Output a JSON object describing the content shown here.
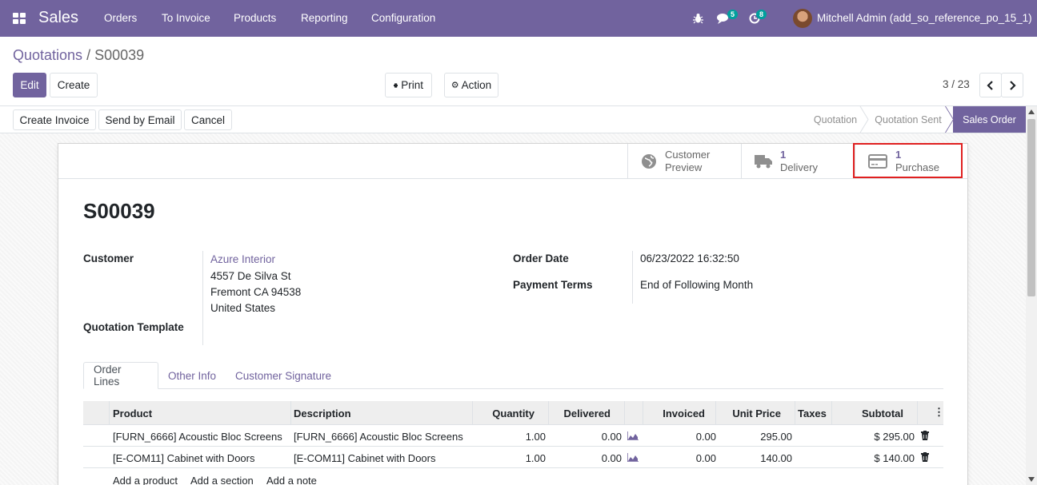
{
  "navbar": {
    "app": "Sales",
    "menu": [
      "Orders",
      "To Invoice",
      "Products",
      "Reporting",
      "Configuration"
    ],
    "chat_count": "5",
    "activity_count": "8",
    "user": "Mitchell Admin (add_so_reference_po_15_1)"
  },
  "breadcrumb": {
    "parent": "Quotations",
    "sep": " / ",
    "current": "S00039"
  },
  "buttons": {
    "edit": "Edit",
    "create": "Create",
    "print": "Print",
    "action": "Action"
  },
  "pager": {
    "value": "3 / 23"
  },
  "header_buttons": {
    "create_invoice": "Create Invoice",
    "send_email": "Send by Email",
    "cancel": "Cancel"
  },
  "stages": [
    "Quotation",
    "Quotation Sent",
    "Sales Order"
  ],
  "smart_buttons": {
    "preview_line1": "Customer",
    "preview_line2": "Preview",
    "delivery_count": "1",
    "delivery_label": "Delivery",
    "purchase_count": "1",
    "purchase_label": "Purchase"
  },
  "record": {
    "name": "S00039",
    "customer_label": "Customer",
    "customer_name": "Azure Interior",
    "address": [
      "4557 De Silva St",
      "Fremont CA 94538",
      "United States"
    ],
    "template_label": "Quotation Template",
    "order_date_label": "Order Date",
    "order_date": "06/23/2022 16:32:50",
    "payment_terms_label": "Payment Terms",
    "payment_terms": "End of Following Month"
  },
  "tabs": [
    "Order Lines",
    "Other Info",
    "Customer Signature"
  ],
  "table": {
    "headers": {
      "product": "Product",
      "description": "Description",
      "quantity": "Quantity",
      "delivered": "Delivered",
      "invoiced": "Invoiced",
      "unit_price": "Unit Price",
      "taxes": "Taxes",
      "subtotal": "Subtotal"
    },
    "rows": [
      {
        "product": "[FURN_6666] Acoustic Bloc Screens",
        "description": "[FURN_6666] Acoustic Bloc Screens",
        "quantity": "1.00",
        "delivered": "0.00",
        "invoiced": "0.00",
        "unit_price": "295.00",
        "taxes": "",
        "subtotal": "$ 295.00"
      },
      {
        "product": "[E-COM11] Cabinet with Doors",
        "description": "[E-COM11] Cabinet with Doors",
        "quantity": "1.00",
        "delivered": "0.00",
        "invoiced": "0.00",
        "unit_price": "140.00",
        "taxes": "",
        "subtotal": "$ 140.00"
      }
    ],
    "add_product": "Add a product",
    "add_section": "Add a section",
    "add_note": "Add a note"
  },
  "colors": {
    "brand": "#71639e",
    "highlight": "#e02020"
  }
}
